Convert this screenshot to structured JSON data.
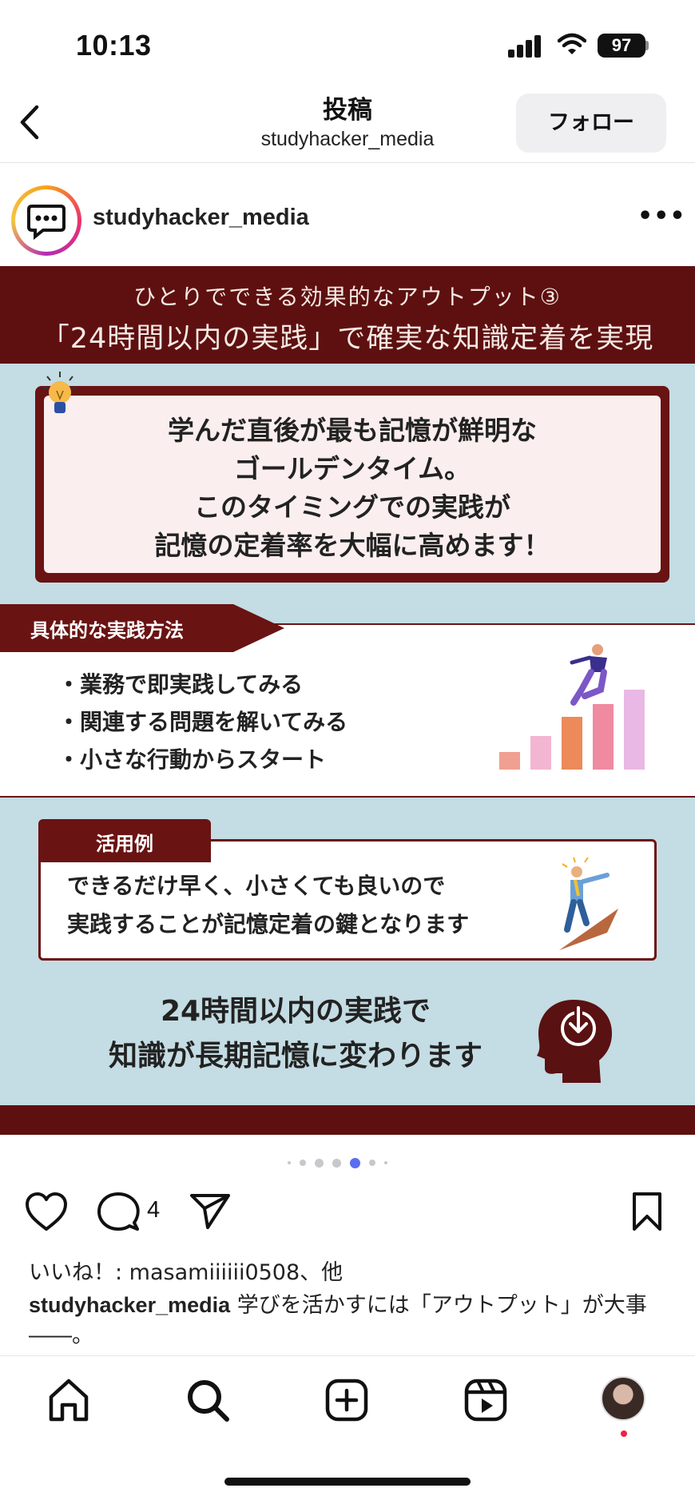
{
  "status_bar": {
    "time": "10:13",
    "battery": "97"
  },
  "header": {
    "title": "投稿",
    "subtitle": "studyhacker_media",
    "follow_label": "フォロー"
  },
  "post": {
    "username": "studyhacker_media",
    "image": {
      "banner_line1": "ひとりでできる効果的なアウトプット③",
      "banner_line2": "「24時間以内の実践」で確実な知識定着を実現",
      "callout_lines": [
        "学んだ直後が最も記憶が鮮明な",
        "ゴールデンタイム。",
        "このタイミングでの実践が",
        "記憶の定着率を大幅に高めます！"
      ],
      "methods_title": "具体的な実践方法",
      "methods": [
        "・業務で即実践してみる",
        "・関連する問題を解いてみる",
        "・小さな行動からスタート"
      ],
      "example_title": "活用例",
      "example_lines": [
        "できるだけ早く、小さくても良いので",
        "実践することが記憶定着の鍵となります"
      ],
      "summary_lines": [
        "24時間以内の実践で",
        "知識が長期記憶に変わります"
      ]
    },
    "carousel": {
      "total": 7,
      "active_index": 4
    },
    "comment_count": "4",
    "likes_text": "いいね！: masamiiiiii0508、他",
    "caption_user": "studyhacker_media",
    "caption_text": " 学びを活かすには「アウトプット」が大事――。"
  },
  "colors": {
    "maroon": "#5e1010",
    "image_bg": "#c4dce3",
    "callout_bg": "#fbeeee",
    "active_dot": "#5b6cf0"
  },
  "icons": {
    "tabbar": [
      "home-icon",
      "search-icon",
      "create-icon",
      "reels-icon",
      "profile-avatar"
    ]
  }
}
